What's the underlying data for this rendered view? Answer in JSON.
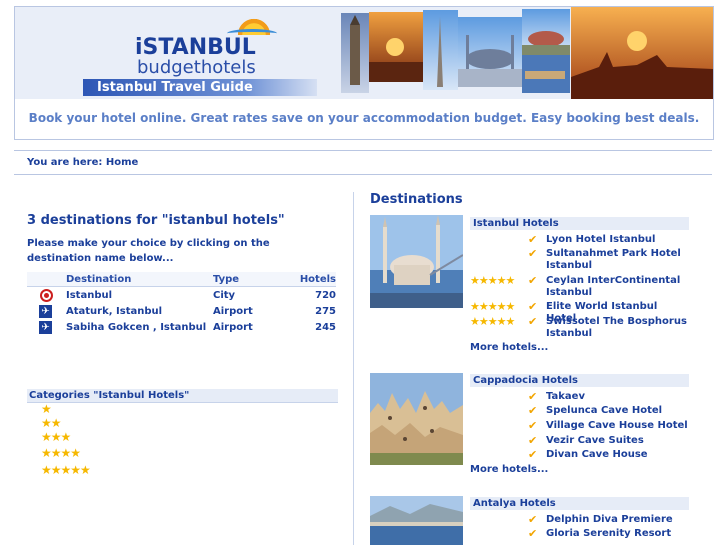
{
  "header": {
    "logo_line1": "iSTANBUL",
    "logo_line2": "budgethotels",
    "guide_label": "Istanbul Travel Guide",
    "tagline": "Book your hotel online. Great rates save on your accommodation budget. Easy booking best deals."
  },
  "breadcrumb": "You are here: Home",
  "left": {
    "title": "3 destinations for \"istanbul hotels\"",
    "instructions": "Please make your choice by clicking on the destination name below...",
    "columns": [
      "Destination",
      "Type",
      "Hotels"
    ],
    "rows": [
      {
        "icon": "city-icon",
        "name": "Istanbul",
        "type": "City",
        "hotels": "720"
      },
      {
        "icon": "airport-icon",
        "name": "Ataturk, Istanbul",
        "type": "Airport",
        "hotels": "275"
      },
      {
        "icon": "airport-icon",
        "name": "Sabiha Gokcen , Istanbul",
        "type": "Airport",
        "hotels": "245"
      }
    ],
    "categories_title": "Categories \"Istanbul Hotels\"",
    "categories": [
      "★",
      "★★",
      "★★★",
      "★★★★",
      "★★★★★"
    ]
  },
  "destinations": {
    "title": "Destinations",
    "cards": [
      {
        "name": "Istanbul Hotels",
        "hotels": [
          {
            "stars": "",
            "name": "Lyon Hotel Istanbul"
          },
          {
            "stars": "",
            "name": "Sultanahmet Park Hotel Istanbul"
          },
          {
            "stars": "★★★★★",
            "name": "Ceylan InterContinental Istanbul"
          },
          {
            "stars": "★★★★★",
            "name": "Elite World Istanbul Hotel"
          },
          {
            "stars": "★★★★★",
            "name": "Swissotel The Bosphorus Istanbul"
          }
        ],
        "more": "More hotels..."
      },
      {
        "name": "Cappadocia Hotels",
        "hotels": [
          {
            "stars": "",
            "name": "Takaev"
          },
          {
            "stars": "",
            "name": "Spelunca Cave Hotel"
          },
          {
            "stars": "",
            "name": "Village Cave House Hotel"
          },
          {
            "stars": "",
            "name": "Vezir Cave Suites"
          },
          {
            "stars": "",
            "name": "Divan Cave House"
          }
        ],
        "more": "More hotels..."
      },
      {
        "name": "Antalya Hotels",
        "hotels": [
          {
            "stars": "",
            "name": "Delphin Diva Premiere"
          },
          {
            "stars": "",
            "name": "Gloria Serenity Resort"
          }
        ]
      }
    ]
  },
  "colors": {
    "accent": "#1b3f9a",
    "star": "#f6b800",
    "check": "#f2a500",
    "city_icon": "#cc1f1f"
  }
}
